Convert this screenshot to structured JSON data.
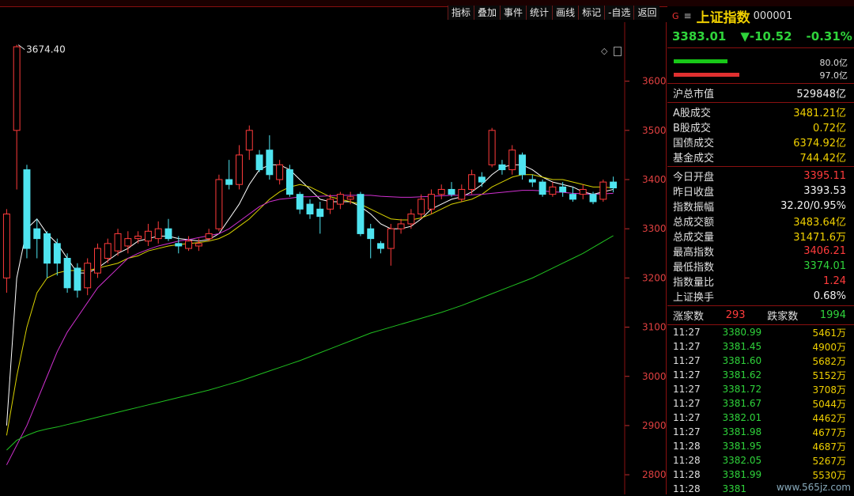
{
  "toolbar": {
    "items": [
      "指标",
      "叠加",
      "事件",
      "统计",
      "画线",
      "标记",
      "-自选",
      "返回"
    ]
  },
  "chart_data": {
    "type": "candlestick",
    "ylim": [
      2760,
      3720
    ],
    "y_ticks": [
      3600,
      3500,
      3400,
      3300,
      3200,
      3100,
      3000,
      2900,
      2800
    ],
    "max_label": "3674.40",
    "candles": [
      {
        "o": 3200,
        "c": 3330,
        "h": 3340,
        "l": 3170
      },
      {
        "o": 3500,
        "c": 3670,
        "h": 3674,
        "l": 3380
      },
      {
        "o": 3420,
        "c": 3260,
        "h": 3430,
        "l": 3240
      },
      {
        "o": 3300,
        "c": 3280,
        "h": 3320,
        "l": 3240
      },
      {
        "o": 3290,
        "c": 3230,
        "h": 3295,
        "l": 3200
      },
      {
        "o": 3270,
        "c": 3230,
        "h": 3280,
        "l": 3205
      },
      {
        "o": 3240,
        "c": 3180,
        "h": 3250,
        "l": 3170
      },
      {
        "o": 3220,
        "c": 3175,
        "h": 3230,
        "l": 3160
      },
      {
        "o": 3180,
        "c": 3230,
        "h": 3240,
        "l": 3165
      },
      {
        "o": 3210,
        "c": 3260,
        "h": 3270,
        "l": 3200
      },
      {
        "o": 3240,
        "c": 3270,
        "h": 3280,
        "l": 3230
      },
      {
        "o": 3255,
        "c": 3290,
        "h": 3300,
        "l": 3245
      },
      {
        "o": 3265,
        "c": 3280,
        "h": 3295,
        "l": 3250
      },
      {
        "o": 3280,
        "c": 3285,
        "h": 3295,
        "l": 3270
      },
      {
        "o": 3275,
        "c": 3295,
        "h": 3310,
        "l": 3265
      },
      {
        "o": 3280,
        "c": 3300,
        "h": 3315,
        "l": 3270
      },
      {
        "o": 3300,
        "c": 3280,
        "h": 3320,
        "l": 3275
      },
      {
        "o": 3270,
        "c": 3265,
        "h": 3285,
        "l": 3250
      },
      {
        "o": 3260,
        "c": 3275,
        "h": 3285,
        "l": 3255
      },
      {
        "o": 3265,
        "c": 3270,
        "h": 3280,
        "l": 3255
      },
      {
        "o": 3280,
        "c": 3290,
        "h": 3300,
        "l": 3275
      },
      {
        "o": 3300,
        "c": 3400,
        "h": 3410,
        "l": 3295
      },
      {
        "o": 3400,
        "c": 3390,
        "h": 3440,
        "l": 3380
      },
      {
        "o": 3390,
        "c": 3450,
        "h": 3470,
        "l": 3380
      },
      {
        "o": 3460,
        "c": 3500,
        "h": 3510,
        "l": 3440
      },
      {
        "o": 3450,
        "c": 3420,
        "h": 3460,
        "l": 3415
      },
      {
        "o": 3460,
        "c": 3410,
        "h": 3490,
        "l": 3400
      },
      {
        "o": 3400,
        "c": 3430,
        "h": 3440,
        "l": 3390
      },
      {
        "o": 3420,
        "c": 3370,
        "h": 3430,
        "l": 3365
      },
      {
        "o": 3370,
        "c": 3340,
        "h": 3375,
        "l": 3330
      },
      {
        "o": 3350,
        "c": 3330,
        "h": 3360,
        "l": 3320
      },
      {
        "o": 3340,
        "c": 3325,
        "h": 3355,
        "l": 3290
      },
      {
        "o": 3340,
        "c": 3360,
        "h": 3370,
        "l": 3330
      },
      {
        "o": 3350,
        "c": 3370,
        "h": 3375,
        "l": 3340
      },
      {
        "o": 3360,
        "c": 3365,
        "h": 3375,
        "l": 3350
      },
      {
        "o": 3370,
        "c": 3290,
        "h": 3375,
        "l": 3285
      },
      {
        "o": 3300,
        "c": 3280,
        "h": 3310,
        "l": 3240
      },
      {
        "o": 3270,
        "c": 3260,
        "h": 3275,
        "l": 3250
      },
      {
        "o": 3260,
        "c": 3300,
        "h": 3310,
        "l": 3225
      },
      {
        "o": 3300,
        "c": 3310,
        "h": 3320,
        "l": 3290
      },
      {
        "o": 3310,
        "c": 3330,
        "h": 3340,
        "l": 3300
      },
      {
        "o": 3330,
        "c": 3360,
        "h": 3370,
        "l": 3320
      },
      {
        "o": 3340,
        "c": 3370,
        "h": 3380,
        "l": 3330
      },
      {
        "o": 3370,
        "c": 3380,
        "h": 3390,
        "l": 3360
      },
      {
        "o": 3380,
        "c": 3370,
        "h": 3395,
        "l": 3365
      },
      {
        "o": 3360,
        "c": 3380,
        "h": 3390,
        "l": 3355
      },
      {
        "o": 3380,
        "c": 3410,
        "h": 3420,
        "l": 3370
      },
      {
        "o": 3405,
        "c": 3395,
        "h": 3415,
        "l": 3385
      },
      {
        "o": 3430,
        "c": 3500,
        "h": 3505,
        "l": 3425
      },
      {
        "o": 3430,
        "c": 3420,
        "h": 3440,
        "l": 3410
      },
      {
        "o": 3420,
        "c": 3460,
        "h": 3470,
        "l": 3410
      },
      {
        "o": 3450,
        "c": 3410,
        "h": 3455,
        "l": 3400
      },
      {
        "o": 3400,
        "c": 3395,
        "h": 3410,
        "l": 3385
      },
      {
        "o": 3395,
        "c": 3370,
        "h": 3400,
        "l": 3365
      },
      {
        "o": 3370,
        "c": 3385,
        "h": 3395,
        "l": 3365
      },
      {
        "o": 3385,
        "c": 3375,
        "h": 3395,
        "l": 3365
      },
      {
        "o": 3370,
        "c": 3360,
        "h": 3385,
        "l": 3355
      },
      {
        "o": 3370,
        "c": 3380,
        "h": 3390,
        "l": 3360
      },
      {
        "o": 3370,
        "c": 3355,
        "h": 3375,
        "l": 3350
      },
      {
        "o": 3360,
        "c": 3395,
        "h": 3400,
        "l": 3355
      },
      {
        "o": 3395,
        "c": 3383,
        "h": 3406,
        "l": 3374
      }
    ],
    "ma_series": [
      {
        "color": "#ffffff",
        "values": [
          2900,
          3200,
          3300,
          3320,
          3290,
          3270,
          3240,
          3210,
          3210,
          3220,
          3235,
          3250,
          3260,
          3275,
          3280,
          3285,
          3285,
          3280,
          3278,
          3275,
          3278,
          3290,
          3320,
          3350,
          3390,
          3420,
          3430,
          3430,
          3420,
          3400,
          3380,
          3360,
          3355,
          3355,
          3355,
          3345,
          3330,
          3310,
          3300,
          3300,
          3305,
          3320,
          3340,
          3350,
          3360,
          3365,
          3375,
          3390,
          3410,
          3425,
          3430,
          3430,
          3420,
          3405,
          3395,
          3390,
          3385,
          3375,
          3370,
          3375,
          3380
        ]
      },
      {
        "color": "#d9d200",
        "values": [
          2880,
          3000,
          3100,
          3170,
          3200,
          3210,
          3215,
          3215,
          3215,
          3220,
          3225,
          3230,
          3240,
          3245,
          3255,
          3260,
          3265,
          3268,
          3270,
          3272,
          3275,
          3280,
          3290,
          3305,
          3320,
          3340,
          3360,
          3375,
          3385,
          3390,
          3385,
          3375,
          3365,
          3360,
          3355,
          3350,
          3340,
          3330,
          3320,
          3318,
          3318,
          3322,
          3330,
          3340,
          3350,
          3355,
          3360,
          3370,
          3385,
          3395,
          3405,
          3410,
          3410,
          3405,
          3400,
          3400,
          3395,
          3390,
          3385,
          3385,
          3383
        ]
      },
      {
        "color": "#d030d0",
        "values": [
          2820,
          2860,
          2900,
          2950,
          3000,
          3050,
          3090,
          3120,
          3150,
          3180,
          3200,
          3220,
          3240,
          3250,
          3258,
          3265,
          3270,
          3275,
          3278,
          3282,
          3286,
          3290,
          3300,
          3315,
          3330,
          3345,
          3355,
          3360,
          3362,
          3365,
          3365,
          3366,
          3367,
          3368,
          3368,
          3368,
          3368,
          3366,
          3365,
          3364,
          3364,
          3365,
          3366,
          3367,
          3368,
          3368,
          3369,
          3370,
          3372,
          3374,
          3376,
          3378,
          3378,
          3377,
          3375,
          3374,
          3372,
          3371,
          3370,
          3371,
          3372
        ]
      },
      {
        "color": "#20c020",
        "values": [
          2850,
          2870,
          2880,
          2888,
          2893,
          2897,
          2902,
          2907,
          2912,
          2917,
          2922,
          2927,
          2932,
          2937,
          2942,
          2947,
          2952,
          2957,
          2962,
          2967,
          2972,
          2978,
          2984,
          2990,
          2997,
          3004,
          3011,
          3018,
          3025,
          3032,
          3040,
          3048,
          3056,
          3064,
          3072,
          3080,
          3088,
          3094,
          3100,
          3106,
          3112,
          3118,
          3124,
          3130,
          3137,
          3144,
          3152,
          3160,
          3168,
          3176,
          3184,
          3192,
          3200,
          3210,
          3220,
          3230,
          3240,
          3250,
          3262,
          3274,
          3286
        ]
      }
    ]
  },
  "quote_panel": {
    "g_label": "G",
    "menu_icon": "menu-icon",
    "name": "上证指数",
    "code": "000001",
    "price": "3383.01",
    "change": "▼-10.52",
    "change_pct": "-0.31%",
    "buy_amount": "80.0亿",
    "sell_amount": "97.0亿",
    "buy_fraction": 0.45,
    "sell_fraction": 0.55
  },
  "market_value": {
    "label": "沪总市值",
    "value": "529848亿"
  },
  "volumes": [
    {
      "label": "A股成交",
      "value": "3481.21亿"
    },
    {
      "label": "B股成交",
      "value": "0.72亿"
    },
    {
      "label": "国债成交",
      "value": "6374.92亿"
    },
    {
      "label": "基金成交",
      "value": "744.42亿"
    }
  ],
  "stats": [
    {
      "label": "今日开盘",
      "value": "3395.11",
      "color": "red"
    },
    {
      "label": "昨日收盘",
      "value": "3393.53",
      "color": "white"
    },
    {
      "label": "指数振幅",
      "value": "32.20/0.95%",
      "color": "white"
    },
    {
      "label": "总成交额",
      "value": "3483.64亿",
      "color": "yellow"
    },
    {
      "label": "总成交量",
      "value": "31471.6万",
      "color": "yellow"
    },
    {
      "label": "最高指数",
      "value": "3406.21",
      "color": "red"
    },
    {
      "label": "最低指数",
      "value": "3374.01",
      "color": "green"
    },
    {
      "label": "指数量比",
      "value": "1.24",
      "color": "red"
    },
    {
      "label": "上证换手",
      "value": "0.68%",
      "color": "white"
    }
  ],
  "breadth": {
    "up_label": "涨家数",
    "up_value": "293",
    "down_label": "跌家数",
    "down_value": "1994"
  },
  "ticks": [
    {
      "time": "11:27",
      "price": "3380.99",
      "vol": "5461万"
    },
    {
      "time": "11:27",
      "price": "3381.45",
      "vol": "4900万"
    },
    {
      "time": "11:27",
      "price": "3381.60",
      "vol": "5682万"
    },
    {
      "time": "11:27",
      "price": "3381.62",
      "vol": "5152万"
    },
    {
      "time": "11:27",
      "price": "3381.72",
      "vol": "3708万"
    },
    {
      "time": "11:27",
      "price": "3381.67",
      "vol": "5044万"
    },
    {
      "time": "11:27",
      "price": "3382.01",
      "vol": "4462万"
    },
    {
      "time": "11:27",
      "price": "3381.98",
      "vol": "4677万"
    },
    {
      "time": "11:28",
      "price": "3381.95",
      "vol": "4687万"
    },
    {
      "time": "11:28",
      "price": "3382.05",
      "vol": "5267万"
    },
    {
      "time": "11:28",
      "price": "3381.99",
      "vol": "5530万"
    },
    {
      "time": "11:28",
      "price": "3381",
      "vol": ""
    }
  ],
  "watermark": "www.565jz.com"
}
